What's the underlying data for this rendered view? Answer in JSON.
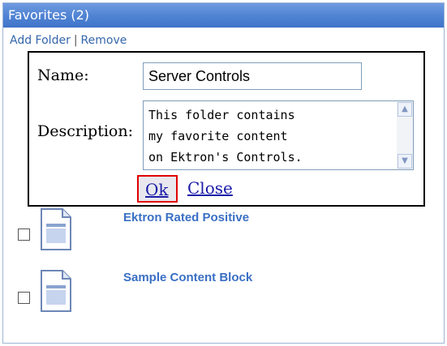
{
  "panel": {
    "title": "Favorites (2)",
    "actions": {
      "add_folder": "Add Folder",
      "separator": "|",
      "remove": "Remove"
    }
  },
  "dialog": {
    "name_label": "Name:",
    "name_value": "Server Controls",
    "description_label": "Description:",
    "description_value": "This folder contains\nmy favorite content\non Ektron's Controls.",
    "ok_label": "Ok",
    "close_label": "Close"
  },
  "favorites": [
    {
      "title": "Ektron Rated Positive",
      "icon": "document-icon",
      "checked": false
    },
    {
      "title": "Sample Content Block",
      "icon": "document-icon",
      "checked": false
    }
  ],
  "colors": {
    "titlebar": "#4f82d3",
    "link": "#1a1aa8",
    "item_title": "#3a6fc4",
    "ok_highlight": "#e00000"
  }
}
